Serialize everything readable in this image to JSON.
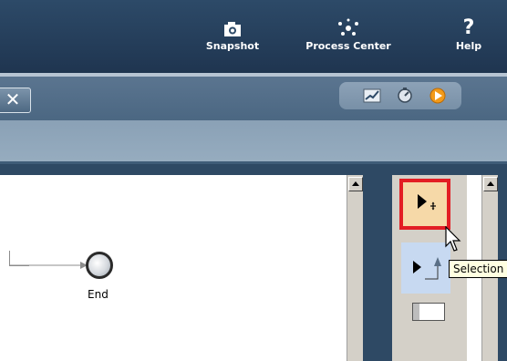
{
  "toolbar": {
    "snapshot_label": "Snapshot",
    "process_center_label": "Process Center",
    "help_label": "Help",
    "help_glyph": "?"
  },
  "window": {
    "close_glyph": "✕"
  },
  "diagram": {
    "end_label": "End"
  },
  "palette": {
    "tooltip": "Selection"
  },
  "colors": {
    "toolbar_bg": "#2d4a68",
    "title_band": "#4b6782",
    "selected_tool_border": "#e31e24",
    "selected_tool_bg": "#f6d9a8",
    "tooltip_bg": "#ffffe1"
  },
  "icons": [
    "camera-icon",
    "process-center-icon",
    "help-icon",
    "close-icon",
    "chart-icon",
    "gauge-icon",
    "play-icon",
    "selection-tool-icon",
    "connection-tool-icon",
    "lane-tool-icon",
    "mouse-cursor-icon"
  ]
}
